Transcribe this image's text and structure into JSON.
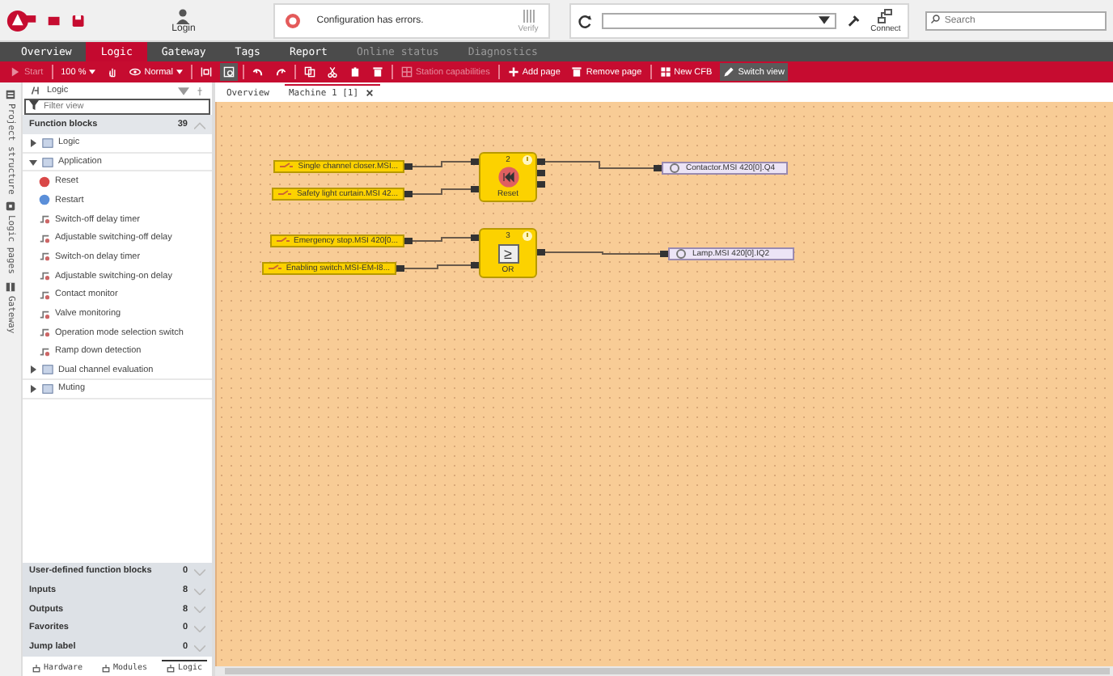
{
  "header": {
    "login": "Login",
    "message": "Configuration has errors.",
    "verify": "Verify",
    "connect": "Connect",
    "search": {
      "placeholder": "Search"
    }
  },
  "nav_tabs": [
    {
      "label": "Overview",
      "selected": false,
      "disabled": false
    },
    {
      "label": "Logic",
      "selected": true,
      "disabled": false
    },
    {
      "label": "Gateway",
      "selected": false,
      "disabled": false
    },
    {
      "label": "Tags",
      "selected": false,
      "disabled": false
    },
    {
      "label": "Report",
      "selected": false,
      "disabled": false
    },
    {
      "label": "Online status",
      "selected": false,
      "disabled": true
    },
    {
      "label": "Diagnostics",
      "selected": false,
      "disabled": true
    }
  ],
  "toolbar": [
    {
      "kind": "button",
      "label": "Start",
      "disabled": true
    },
    {
      "kind": "dropdown",
      "label": "100 %",
      "disabled": false
    },
    {
      "kind": "icon",
      "disabled": false
    },
    {
      "kind": "dropdown",
      "label": "Normal",
      "disabled": false
    },
    {
      "kind": "icon",
      "disabled": false
    },
    {
      "kind": "icon",
      "disabled": false,
      "selected": true
    },
    {
      "kind": "icon",
      "disabled": false
    },
    {
      "kind": "icon",
      "disabled": false
    },
    {
      "kind": "icon",
      "disabled": false
    },
    {
      "kind": "icon",
      "disabled": false
    },
    {
      "kind": "icon",
      "disabled": false
    },
    {
      "kind": "icon",
      "disabled": false
    },
    {
      "kind": "button",
      "label": "Station capabilities",
      "disabled": true
    },
    {
      "kind": "button",
      "label": "Add page",
      "disabled": false
    },
    {
      "kind": "button",
      "label": "Remove page",
      "disabled": false
    },
    {
      "kind": "button",
      "label": "New CFB",
      "disabled": false
    },
    {
      "kind": "button",
      "label": "Switch view",
      "disabled": false,
      "selected": true
    }
  ],
  "side_strip": [
    {
      "label": "Project structure"
    },
    {
      "label": "Logic pages"
    },
    {
      "label": "Gateway"
    }
  ],
  "sidebar": {
    "title": "Logic",
    "filter": {
      "placeholder": "Filter view"
    },
    "section": {
      "title": "Function blocks",
      "count": "39"
    },
    "tree": [
      {
        "label": "Logic",
        "expanded": false
      },
      {
        "label": "Application",
        "expanded": true,
        "children": [
          {
            "label": "Reset"
          },
          {
            "label": "Restart"
          },
          {
            "label": "Switch-off delay timer"
          },
          {
            "label": "Adjustable switching-off delay"
          },
          {
            "label": "Switch-on delay timer"
          },
          {
            "label": "Adjustable switching-on delay"
          },
          {
            "label": "Contact monitor"
          },
          {
            "label": "Valve monitoring"
          },
          {
            "label": "Operation mode selection switch"
          },
          {
            "label": "Ramp down detection"
          }
        ]
      },
      {
        "label": "Dual channel evaluation",
        "expanded": false
      },
      {
        "label": "Muting",
        "expanded": false
      }
    ],
    "groups": [
      {
        "title": "User-defined function blocks",
        "count": "0"
      },
      {
        "title": "Inputs",
        "count": "8"
      },
      {
        "title": "Outputs",
        "count": "8"
      },
      {
        "title": "Favorites",
        "count": "0"
      },
      {
        "title": "Jump label",
        "count": "0"
      }
    ],
    "bottom_tabs": [
      {
        "label": "Hardware",
        "selected": false
      },
      {
        "label": "Modules",
        "selected": false
      },
      {
        "label": "Logic",
        "selected": true
      }
    ]
  },
  "doc_tabs": [
    {
      "label": "Overview",
      "selected": false,
      "closable": false
    },
    {
      "label": "Machine 1 [1]",
      "selected": true,
      "closable": true
    }
  ],
  "canvas": {
    "inputs": [
      {
        "label": "Single channel closer.MSI..."
      },
      {
        "label": "Safety light curtain.MSI 42..."
      },
      {
        "label": "Emergency stop.MSI 420[0..."
      },
      {
        "label": "Enabling switch.MSI-EM-I8..."
      }
    ],
    "blocks": [
      {
        "kind": "reset",
        "number": "2",
        "label": "Reset"
      },
      {
        "kind": "or",
        "number": "3",
        "label": "OR",
        "symbol": "≥"
      }
    ],
    "outputs": [
      {
        "label": "Contactor.MSI 420[0].Q4"
      },
      {
        "label": "Lamp.MSI 420[0].IQ2"
      }
    ]
  }
}
